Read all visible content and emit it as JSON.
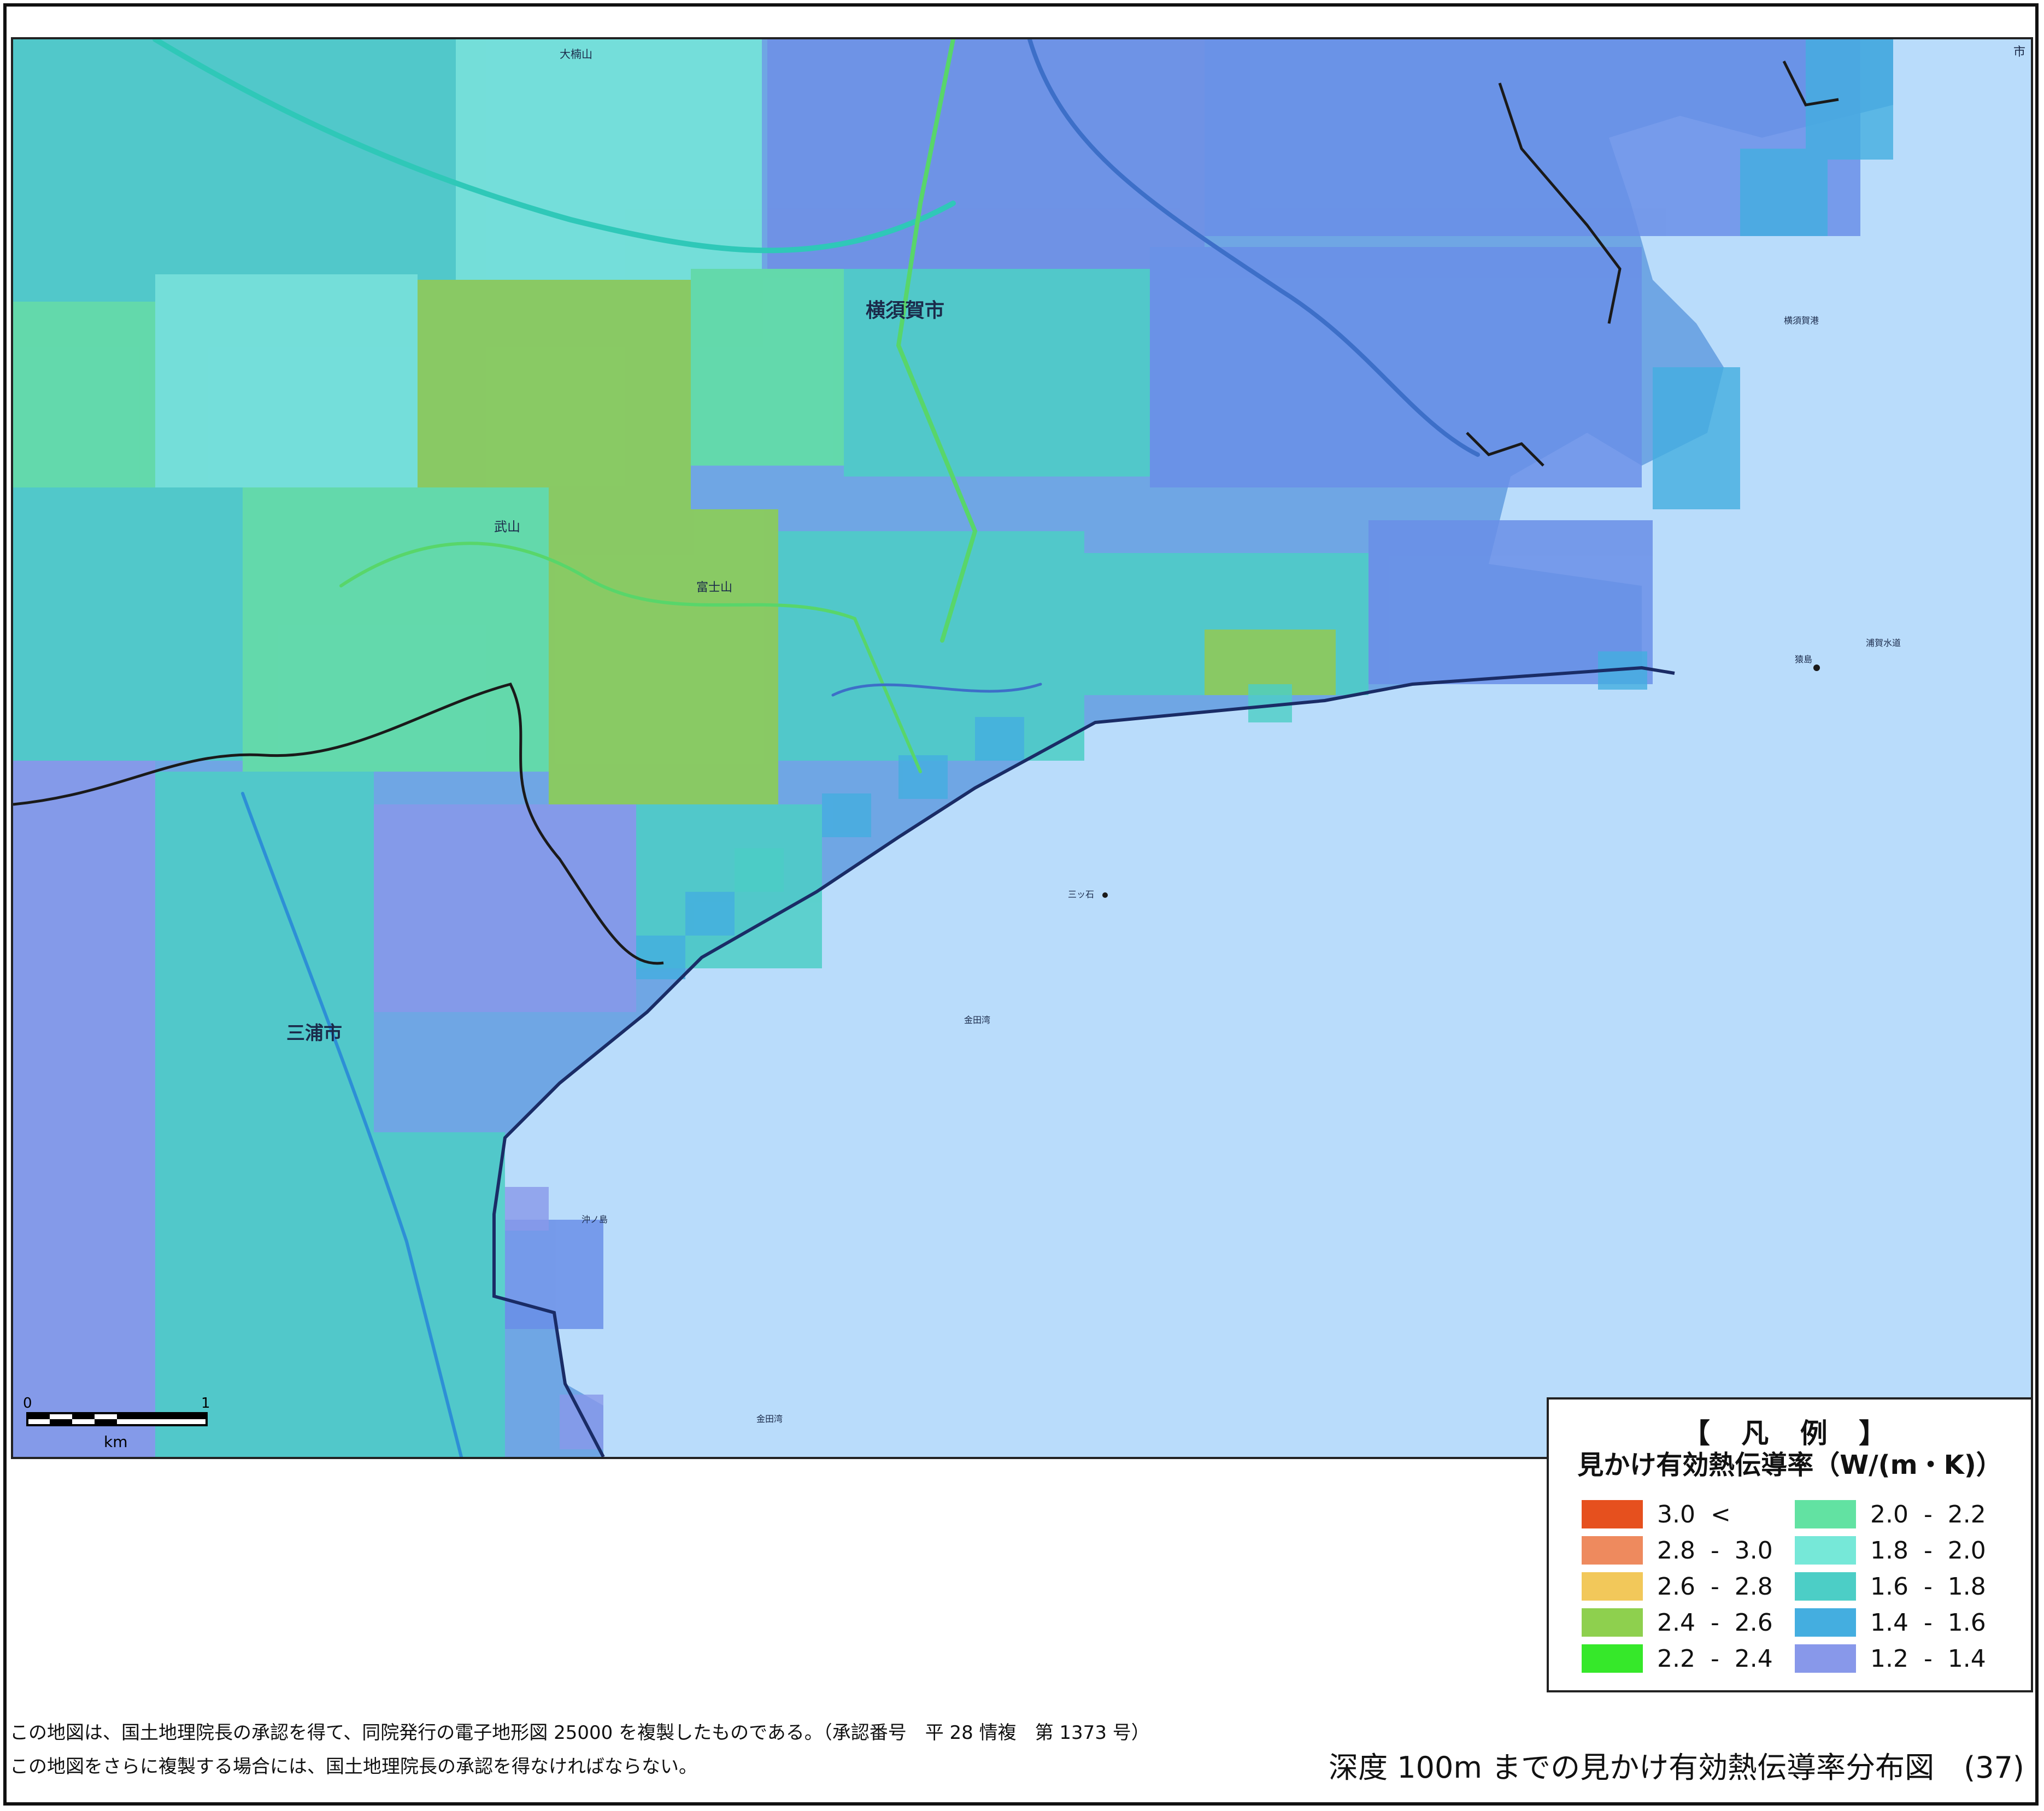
{
  "map": {
    "labels": {
      "yokosuka_city": "横須賀市",
      "miura_city": "三浦市",
      "takeyama": "武山",
      "fujiyama": "富士山",
      "okusu": "大楠山",
      "kanadawan_1": "金田湾",
      "kanadawan_2": "金田湾",
      "sarushima": "猿島",
      "mitsuishi": "三ッ石",
      "okinoshima": "沖ノ島",
      "yokosuka_port": "横須賀港",
      "shi_edge": "市",
      "uraga_channel": "浦賀水道"
    }
  },
  "scale_bar": {
    "zero": "0",
    "one": "1",
    "unit": "km"
  },
  "legend": {
    "title": "【 凡 例 】",
    "subtitle": "見かけ有効熱伝導率（W/(m・K)）",
    "items": [
      {
        "label": "3.0  <",
        "color": "#e6501e"
      },
      {
        "label": "2.8  -  3.0",
        "color": "#ee8a5e"
      },
      {
        "label": "2.6  -  2.8",
        "color": "#f2c85a"
      },
      {
        "label": "2.4  -  2.6",
        "color": "#8ed04e"
      },
      {
        "label": "2.2  -  2.4",
        "color": "#36e82a"
      },
      {
        "label": "2.0  -  2.2",
        "color": "#62e2a2"
      },
      {
        "label": "1.8  -  2.0",
        "color": "#76e8d8"
      },
      {
        "label": "1.6  -  1.8",
        "color": "#4ccec6"
      },
      {
        "label": "1.4  -  1.6",
        "color": "#44aee0"
      },
      {
        "label": "1.2  -  1.4",
        "color": "#8898ea"
      }
    ]
  },
  "notes": {
    "line1": "この地図は、国土地理院長の承認を得て、同院発行の電子地形図 25000 を複製したものである。（承認番号　平 28 情複　第 1373 号）",
    "line2": "この地図をさらに複製する場合には、国土地理院長の承認を得なければならない。"
  },
  "figure_title": "深度 100m までの見かけ有効熱伝導率分布図　(37)",
  "colors": {
    "sea": "#b9dcfb",
    "land_base": "#7ab4e6",
    "boundary": "#1a1a1a"
  }
}
